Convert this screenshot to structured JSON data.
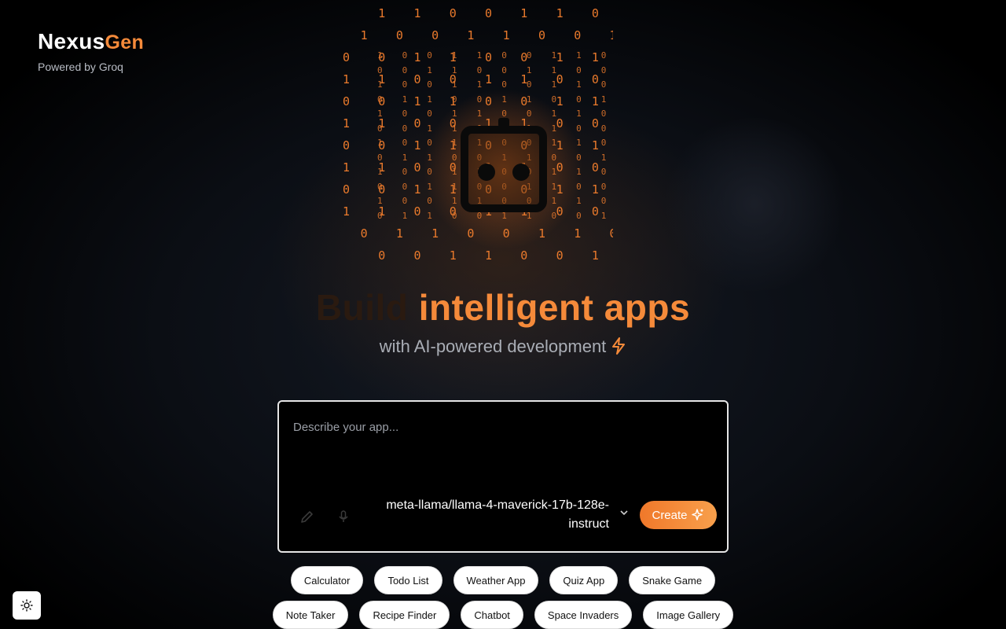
{
  "logo": {
    "name_main": "Nexus",
    "name_accent": "Gen",
    "tagline": "Powered by Groq"
  },
  "hero": {
    "title_dim": "Build",
    "title_accent": "intelligent apps",
    "subtitle": "with AI-powered development"
  },
  "prompt": {
    "placeholder": "Describe your app...",
    "model": "meta-llama/llama-4-maverick-17b-128e-instruct",
    "create_label": "Create"
  },
  "matrix": {
    "big_rows": [
      "  1 1 0 0 1 1 0 0 .",
      " 1 0 0 1 1 0 0 1 1 0 .",
      "0 0 1 1 0 0 1 1 0 0 1 1",
      "1 1 0 0 1 1 0 0 1 1 0 0",
      "0 0 1 1 0 0 1 1 0 0 1 1",
      "1 1 0 0 1 1 0 0 1 1 0 0",
      "0 0 1 1 0 0 1 1 0 0 1 1",
      "1 1 0 0 1 1 0 0 1 1 0 0",
      "0 0 1 1 0 0 1 1 0 0 1 1",
      "1 1 0 0 1 1 0 0 1 1 0 0",
      " 0 1 1 0 0 1 1 0 0 1 .",
      "  0 0 1 1 0 0 1 1 0"
    ],
    "small_rows": [
      "1 0 0 1 1 0 0 1 1 0 0",
      "0 0 1 1 0 0 1 1 0 0 1",
      "1 0 0 1 1 0 0 1 1 0 0",
      "0 1 1 0 0 1 1 0 0 1 1",
      "1 0 0 1 1 0 0 1 1 0 0",
      "0 0 1 1 0 0 1 1 0 0 1",
      "1 0 0 1 1 0 0 1 1 0 0",
      "0 1 1 0 0 1 1 0 0 1 1",
      "1 0 0 1 1 0 0 1 1 0 0",
      "0 0 1 1 0 0 1 1 0 0 1",
      "1 0 0 1 1 0 0 1 1 0 0",
      "0 1 1 0 0 1 1 0 0 1 1"
    ]
  },
  "suggestions_row1": [
    "Calculator",
    "Todo List",
    "Weather App",
    "Quiz App",
    "Snake Game"
  ],
  "suggestions_row2": [
    "Note Taker",
    "Recipe Finder",
    "Chatbot",
    "Space Invaders",
    "Image Gallery"
  ],
  "colors": {
    "accent": "#f58a3a",
    "background": "#000000"
  }
}
